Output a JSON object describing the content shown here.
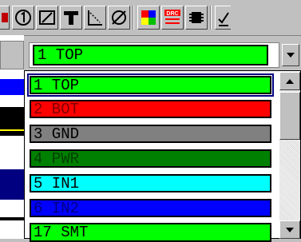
{
  "layer_combo": {
    "selected": "1 TOP"
  },
  "layers": [
    {
      "label": "1 TOP",
      "color": "#00ff00",
      "text_color": "#000000"
    },
    {
      "label": "2 BOT",
      "color": "#ff0000",
      "text_color": "#800000"
    },
    {
      "label": "3 GND",
      "color": "#808080",
      "text_color": "#000000"
    },
    {
      "label": "4 PWR",
      "color": "#008000",
      "text_color": "#004000"
    },
    {
      "label": "5 IN1",
      "color": "#00ffff",
      "text_color": "#000000"
    },
    {
      "label": "6 IN2",
      "color": "#0000ff",
      "text_color": "#000080"
    },
    {
      "label": "17 SMT",
      "color": "#00ff00",
      "text_color": "#000000"
    }
  ],
  "toolbar": {
    "icons": [
      "layer-one-icon",
      "edit-shape-icon",
      "text-icon",
      "dimension-icon",
      "diameter-icon",
      "color-palette-icon",
      "drc-icon",
      "component-icon",
      "checklist-icon"
    ]
  }
}
